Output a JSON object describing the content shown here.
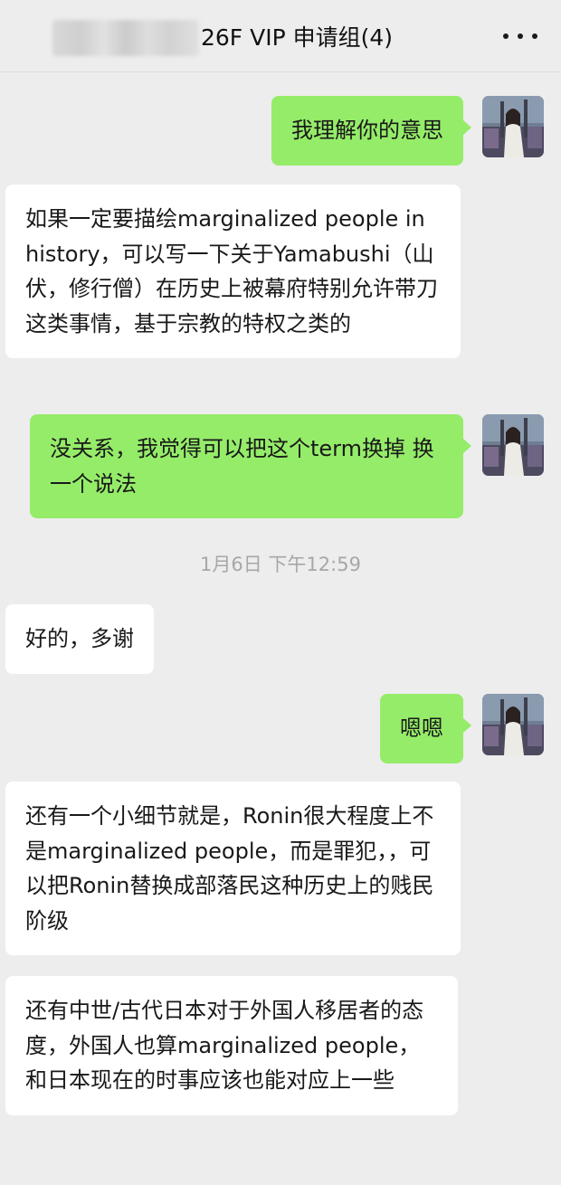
{
  "header": {
    "title": "26F VIP 申请组(4)"
  },
  "messages": [
    {
      "side": "out",
      "text": "我理解你的意思"
    },
    {
      "side": "in",
      "text": "如果一定要描绘marginalized people in history，可以写一下关于Yamabushi（山伏，修行僧）在历史上被幕府特别允许带刀这类事情，基于宗教的特权之类的"
    },
    {
      "side": "out",
      "text": "没关系，我觉得可以把这个term换掉 换一个说法"
    },
    {
      "side": "in",
      "text": "好的，多谢"
    },
    {
      "side": "out",
      "text": "嗯嗯"
    },
    {
      "side": "in",
      "text": "还有一个小细节就是，Ronin很大程度上不是marginalized people，而是罪犯，，可以把Ronin替换成部落民这种历史上的贱民阶级"
    },
    {
      "side": "in",
      "text": "还有中世/古代日本对于外国人移居者的态度，外国人也算marginalized people，和日本现在的时事应该也能对应上一些"
    }
  ],
  "timestamp": "1月6日 下午12:59",
  "icons": {
    "more": "more-dots-icon",
    "avatar": "user-avatar"
  },
  "colors": {
    "outgoing_bubble": "#95ec69",
    "incoming_bubble": "#ffffff",
    "background": "#ededed"
  }
}
